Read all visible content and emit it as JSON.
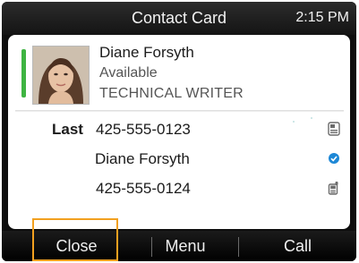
{
  "header": {
    "title": "Contact Card",
    "time": "2:15 PM"
  },
  "contact": {
    "name": "Diane Forsyth",
    "presence": "Available",
    "title": "TECHNICAL WRITER",
    "presence_color": "#3fb442"
  },
  "details": [
    {
      "label": "Last",
      "value": "425-555-0123",
      "icon": "work-phone-icon"
    },
    {
      "label": "",
      "value": "Diane Forsyth",
      "icon": "im-chat-icon"
    },
    {
      "label": "",
      "value": "425-555-0124",
      "icon": "mobile-phone-icon"
    }
  ],
  "softkeys": {
    "close": "Close",
    "menu": "Menu",
    "call": "Call"
  },
  "colors": {
    "focus": "#f2a01f",
    "accent_blue": "#1e88d6"
  }
}
